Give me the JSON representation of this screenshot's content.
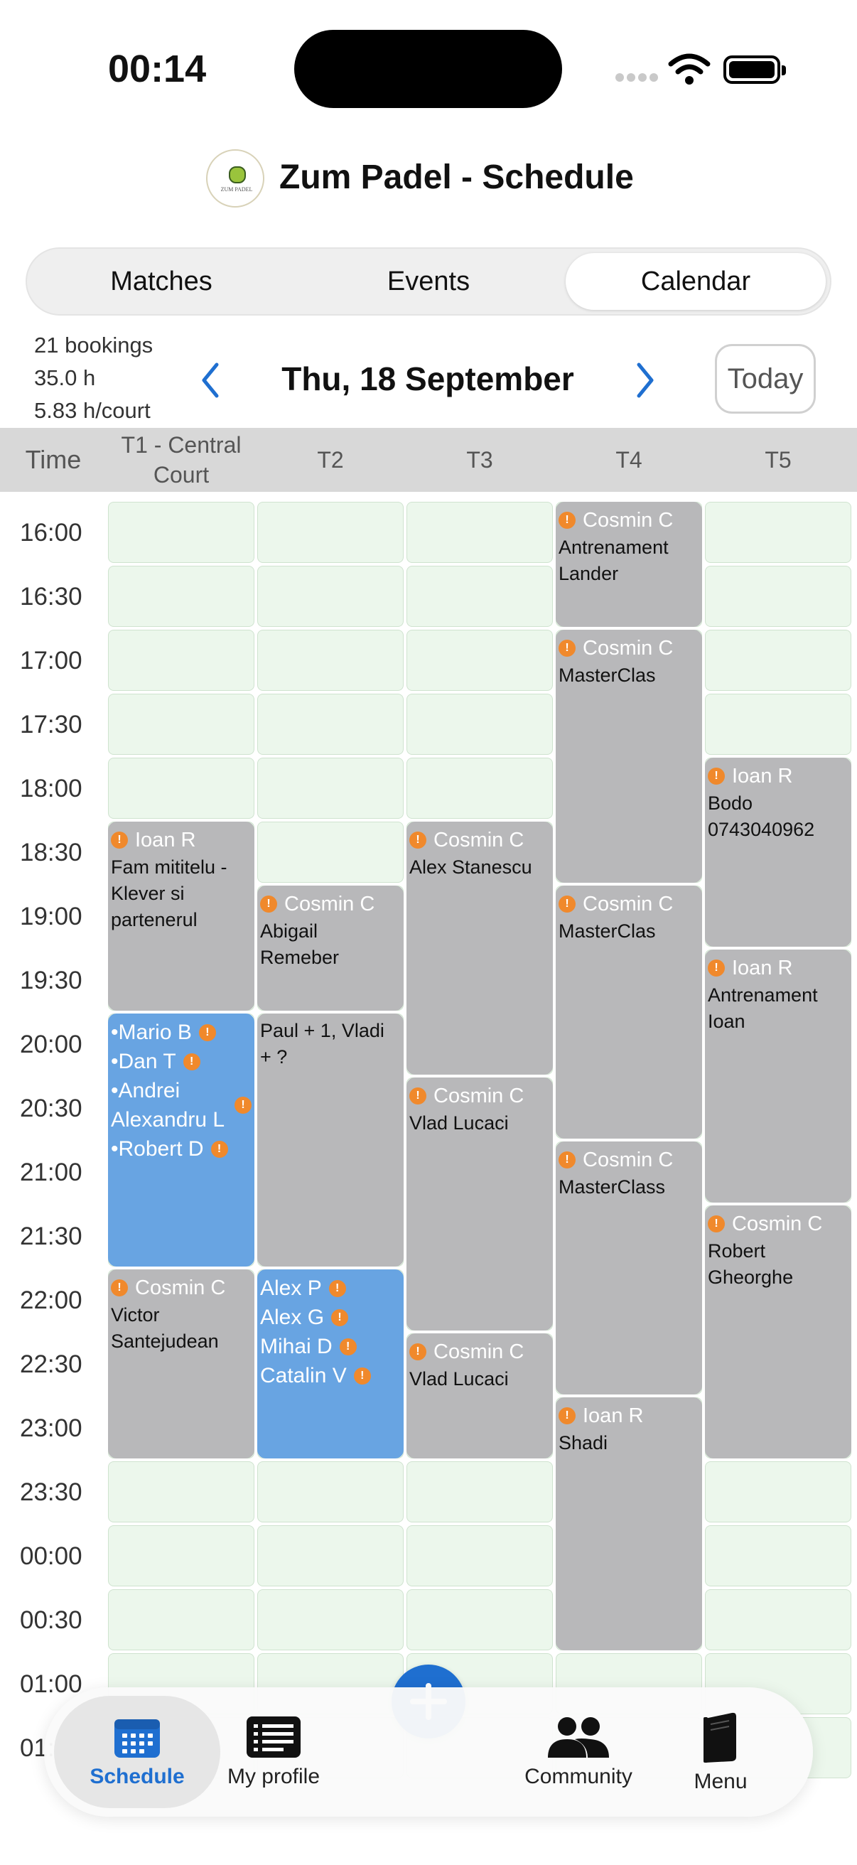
{
  "status_bar": {
    "time": "00:14"
  },
  "header": {
    "title": "Zum Padel - Schedule",
    "logo_text": "ZUM PADEL"
  },
  "segments": [
    {
      "label": "Matches",
      "active": false
    },
    {
      "label": "Events",
      "active": false
    },
    {
      "label": "Calendar",
      "active": true
    }
  ],
  "stats": {
    "bookings": "21 bookings",
    "hours": "35.0 h",
    "per_court": "5.83 h/court"
  },
  "date_nav": {
    "date": "Thu, 18 September",
    "today_label": "Today"
  },
  "grid_header": {
    "time_label": "Time",
    "courts": [
      "T1 - Central Court",
      "T2",
      "T3",
      "T4",
      "T5"
    ]
  },
  "time_slots": [
    "16:00",
    "16:30",
    "17:00",
    "17:30",
    "18:00",
    "18:30",
    "19:00",
    "19:30",
    "20:00",
    "20:30",
    "21:00",
    "21:30",
    "22:00",
    "22:30",
    "23:00",
    "23:30",
    "00:00",
    "00:30",
    "01:00",
    "01:30"
  ],
  "bookings": [
    {
      "court": 0,
      "start": "18:30",
      "end": "20:00",
      "who": "Ioan R",
      "note": "Fam mititelu - Klever si partenerul"
    },
    {
      "court": 0,
      "start": "20:00",
      "end": "22:00",
      "style": "match",
      "players": [
        "•Mario B",
        "•Dan T",
        "•Andrei Alexandru L",
        "•Robert D"
      ]
    },
    {
      "court": 0,
      "start": "22:00",
      "end": "23:30",
      "who": "Cosmin C",
      "note": "Victor Santejudean"
    },
    {
      "court": 1,
      "start": "19:00",
      "end": "20:00",
      "who": "Cosmin C",
      "note": "Abigail Remeber"
    },
    {
      "court": 1,
      "start": "20:00",
      "end": "22:00",
      "note": "Paul + 1, Vladi + ?"
    },
    {
      "court": 1,
      "start": "22:00",
      "end": "23:30",
      "style": "match",
      "players": [
        "Alex P",
        "Alex G",
        "Mihai D",
        "Catalin V"
      ]
    },
    {
      "court": 2,
      "start": "18:30",
      "end": "20:30",
      "who": "Cosmin C",
      "note": "Alex Stanescu"
    },
    {
      "court": 2,
      "start": "20:30",
      "end": "22:30",
      "who": "Cosmin C",
      "note": "Vlad Lucaci"
    },
    {
      "court": 2,
      "start": "22:30",
      "end": "23:30",
      "who": "Cosmin C",
      "note": "Vlad Lucaci"
    },
    {
      "court": 3,
      "start": "16:00",
      "end": "17:00",
      "who": "Cosmin C",
      "note": "Antrenament Lander"
    },
    {
      "court": 3,
      "start": "17:00",
      "end": "19:00",
      "who": "Cosmin C",
      "note": "MasterClas"
    },
    {
      "court": 3,
      "start": "19:00",
      "end": "21:00",
      "who": "Cosmin C",
      "note": "MasterClas"
    },
    {
      "court": 3,
      "start": "21:00",
      "end": "23:00",
      "who": "Cosmin C",
      "note": "MasterClass"
    },
    {
      "court": 3,
      "start": "23:00",
      "end": "01:00",
      "who": "Ioan R",
      "note": "Shadi"
    },
    {
      "court": 4,
      "start": "18:00",
      "end": "19:30",
      "who": "Ioan R",
      "note": "Bodo 0743040962"
    },
    {
      "court": 4,
      "start": "19:30",
      "end": "21:30",
      "who": "Ioan R",
      "note": "Antrenament Ioan"
    },
    {
      "court": 4,
      "start": "21:30",
      "end": "23:30",
      "who": "Cosmin C",
      "note": "Robert Gheorghe"
    }
  ],
  "fab": {
    "icon": "plus-icon"
  },
  "tab_bar": {
    "schedule": "Schedule",
    "profile": "My profile",
    "community": "Community",
    "menu": "Menu"
  },
  "colors": {
    "accent": "#1f6fd0",
    "booking": "#b8b8ba",
    "match": "#68a4e2",
    "free_cell": "#ecf7ec",
    "warning_dot": "#f0892c"
  }
}
